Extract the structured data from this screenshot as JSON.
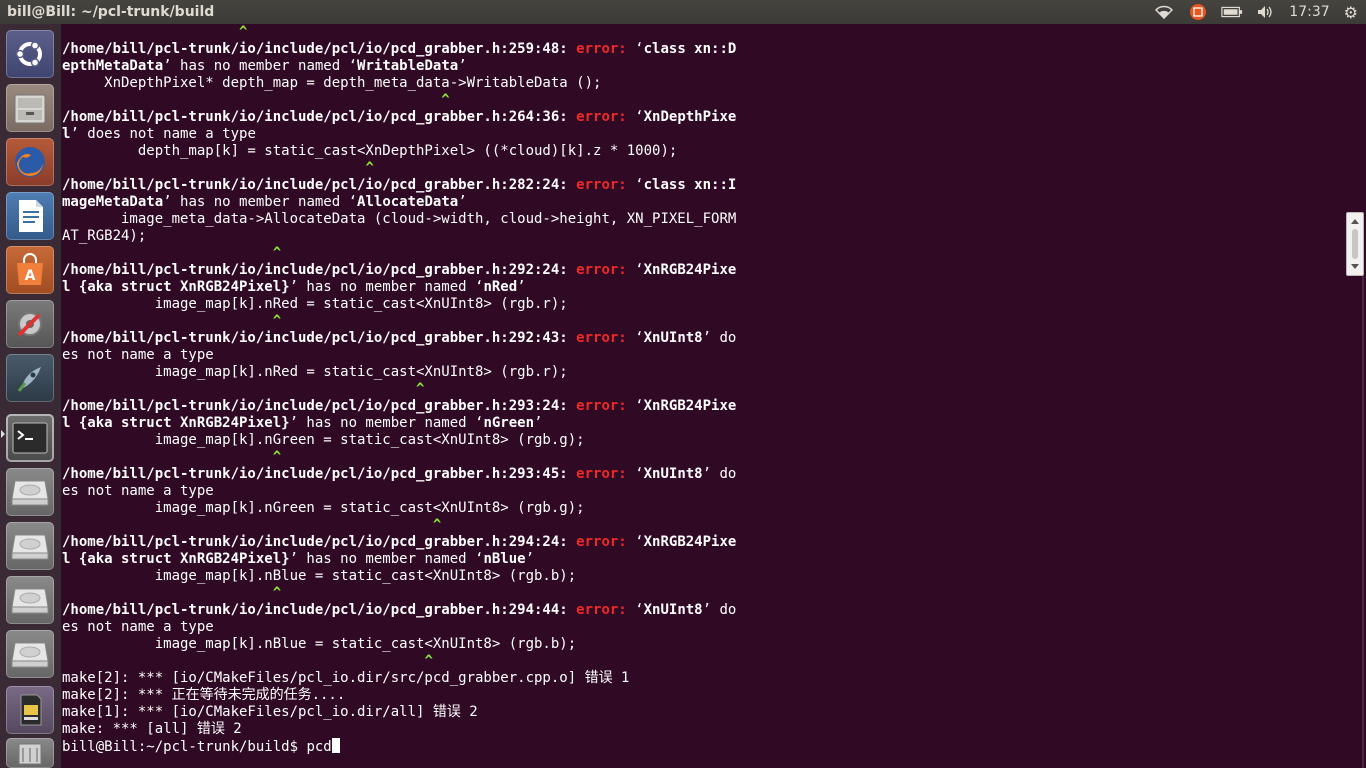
{
  "window": {
    "title": "bill@Bill: ~/pcl-trunk/build"
  },
  "topbar": {
    "clock": "17:37",
    "icons": [
      "wifi-icon",
      "input-method-icon",
      "battery-icon",
      "volume-icon",
      "gear-icon"
    ]
  },
  "launcher": {
    "items": [
      {
        "name": "ubuntu-dash",
        "icon": "ubuntu-logo-icon"
      },
      {
        "name": "files",
        "icon": "file-cabinet-icon"
      },
      {
        "name": "firefox",
        "icon": "firefox-icon"
      },
      {
        "name": "libreoffice-writer",
        "icon": "document-icon"
      },
      {
        "name": "software-center",
        "icon": "shopping-bag-icon"
      },
      {
        "name": "system-settings",
        "icon": "settings-icon"
      },
      {
        "name": "app-launcher",
        "icon": "rocket-icon"
      },
      {
        "name": "terminal",
        "icon": "terminal-icon",
        "active": true
      },
      {
        "name": "drive-1",
        "icon": "hard-drive-icon"
      },
      {
        "name": "drive-2",
        "icon": "hard-drive-icon"
      },
      {
        "name": "drive-3",
        "icon": "hard-drive-icon"
      },
      {
        "name": "drive-4",
        "icon": "hard-drive-icon"
      },
      {
        "name": "sd-card",
        "icon": "sd-card-icon"
      },
      {
        "name": "trash",
        "icon": "trash-icon"
      }
    ]
  },
  "terminal": {
    "prompt": "bill@Bill:~/pcl-trunk/build$ ",
    "input": "pcd",
    "lines": [
      [
        {
          "t": "                     "
        },
        {
          "t": "^",
          "c": "caret"
        }
      ],
      [
        {
          "t": "/home/bill/pcl-trunk/io/include/pcl/io/pcd_grabber.h:259:48: ",
          "c": "b"
        },
        {
          "t": "error: ",
          "c": "err"
        },
        {
          "t": "‘"
        },
        {
          "t": "class xn::D",
          "c": "b"
        }
      ],
      [
        {
          "t": "epthMetaData",
          "c": "b"
        },
        {
          "t": "’ has no member named ‘"
        },
        {
          "t": "WritableData",
          "c": "b"
        },
        {
          "t": "’"
        }
      ],
      [
        {
          "t": "     XnDepthPixel* depth_map = depth_meta_data->WritableData ();"
        }
      ],
      [
        {
          "t": "                                             "
        },
        {
          "t": "^",
          "c": "caret"
        }
      ],
      [
        {
          "t": "/home/bill/pcl-trunk/io/include/pcl/io/pcd_grabber.h:264:36: ",
          "c": "b"
        },
        {
          "t": "error: ",
          "c": "err"
        },
        {
          "t": "‘"
        },
        {
          "t": "XnDepthPixe",
          "c": "b"
        }
      ],
      [
        {
          "t": "l",
          "c": "b"
        },
        {
          "t": "’ does not name a type"
        }
      ],
      [
        {
          "t": "         depth_map[k] = static_cast<XnDepthPixel> ((*cloud)[k].z * 1000);"
        }
      ],
      [
        {
          "t": "                                    "
        },
        {
          "t": "^",
          "c": "caret"
        }
      ],
      [
        {
          "t": "/home/bill/pcl-trunk/io/include/pcl/io/pcd_grabber.h:282:24: ",
          "c": "b"
        },
        {
          "t": "error: ",
          "c": "err"
        },
        {
          "t": "‘"
        },
        {
          "t": "class xn::I",
          "c": "b"
        }
      ],
      [
        {
          "t": "mageMetaData",
          "c": "b"
        },
        {
          "t": "’ has no member named ‘"
        },
        {
          "t": "AllocateData",
          "c": "b"
        },
        {
          "t": "’"
        }
      ],
      [
        {
          "t": "       image_meta_data->AllocateData (cloud->width, cloud->height, XN_PIXEL_FORM"
        }
      ],
      [
        {
          "t": "AT_RGB24);"
        }
      ],
      [
        {
          "t": "                         "
        },
        {
          "t": "^",
          "c": "caret"
        }
      ],
      [
        {
          "t": "/home/bill/pcl-trunk/io/include/pcl/io/pcd_grabber.h:292:24: ",
          "c": "b"
        },
        {
          "t": "error: ",
          "c": "err"
        },
        {
          "t": "‘"
        },
        {
          "t": "XnRGB24Pixe",
          "c": "b"
        }
      ],
      [
        {
          "t": "l {aka struct XnRGB24Pixel}",
          "c": "b"
        },
        {
          "t": "’ has no member named ‘"
        },
        {
          "t": "nRed",
          "c": "b"
        },
        {
          "t": "’"
        }
      ],
      [
        {
          "t": "           image_map[k].nRed = static_cast<XnUInt8> (rgb.r);"
        }
      ],
      [
        {
          "t": "                         "
        },
        {
          "t": "^",
          "c": "caret"
        }
      ],
      [
        {
          "t": "/home/bill/pcl-trunk/io/include/pcl/io/pcd_grabber.h:292:43: ",
          "c": "b"
        },
        {
          "t": "error: ",
          "c": "err"
        },
        {
          "t": "‘"
        },
        {
          "t": "XnUInt8",
          "c": "b"
        },
        {
          "t": "’ do"
        }
      ],
      [
        {
          "t": "es not name a type"
        }
      ],
      [
        {
          "t": "           image_map[k].nRed = static_cast<XnUInt8> (rgb.r);"
        }
      ],
      [
        {
          "t": "                                          "
        },
        {
          "t": "^",
          "c": "caret"
        }
      ],
      [
        {
          "t": "/home/bill/pcl-trunk/io/include/pcl/io/pcd_grabber.h:293:24: ",
          "c": "b"
        },
        {
          "t": "error: ",
          "c": "err"
        },
        {
          "t": "‘"
        },
        {
          "t": "XnRGB24Pixe",
          "c": "b"
        }
      ],
      [
        {
          "t": "l {aka struct XnRGB24Pixel}",
          "c": "b"
        },
        {
          "t": "’ has no member named ‘"
        },
        {
          "t": "nGreen",
          "c": "b"
        },
        {
          "t": "’"
        }
      ],
      [
        {
          "t": "           image_map[k].nGreen = static_cast<XnUInt8> (rgb.g);"
        }
      ],
      [
        {
          "t": "                         "
        },
        {
          "t": "^",
          "c": "caret"
        }
      ],
      [
        {
          "t": "/home/bill/pcl-trunk/io/include/pcl/io/pcd_grabber.h:293:45: ",
          "c": "b"
        },
        {
          "t": "error: ",
          "c": "err"
        },
        {
          "t": "‘"
        },
        {
          "t": "XnUInt8",
          "c": "b"
        },
        {
          "t": "’ do"
        }
      ],
      [
        {
          "t": "es not name a type"
        }
      ],
      [
        {
          "t": "           image_map[k].nGreen = static_cast<XnUInt8> (rgb.g);"
        }
      ],
      [
        {
          "t": "                                            "
        },
        {
          "t": "^",
          "c": "caret"
        }
      ],
      [
        {
          "t": "/home/bill/pcl-trunk/io/include/pcl/io/pcd_grabber.h:294:24: ",
          "c": "b"
        },
        {
          "t": "error: ",
          "c": "err"
        },
        {
          "t": "‘"
        },
        {
          "t": "XnRGB24Pixe",
          "c": "b"
        }
      ],
      [
        {
          "t": "l {aka struct XnRGB24Pixel}",
          "c": "b"
        },
        {
          "t": "’ has no member named ‘"
        },
        {
          "t": "nBlue",
          "c": "b"
        },
        {
          "t": "’"
        }
      ],
      [
        {
          "t": "           image_map[k].nBlue = static_cast<XnUInt8> (rgb.b);"
        }
      ],
      [
        {
          "t": "                         "
        },
        {
          "t": "^",
          "c": "caret"
        }
      ],
      [
        {
          "t": "/home/bill/pcl-trunk/io/include/pcl/io/pcd_grabber.h:294:44: ",
          "c": "b"
        },
        {
          "t": "error: ",
          "c": "err"
        },
        {
          "t": "‘"
        },
        {
          "t": "XnUInt8",
          "c": "b"
        },
        {
          "t": "’ do"
        }
      ],
      [
        {
          "t": "es not name a type"
        }
      ],
      [
        {
          "t": "           image_map[k].nBlue = static_cast<XnUInt8> (rgb.b);"
        }
      ],
      [
        {
          "t": "                                           "
        },
        {
          "t": "^",
          "c": "caret"
        }
      ],
      [
        {
          "t": "make[2]: *** [io/CMakeFiles/pcl_io.dir/src/pcd_grabber.cpp.o] 错误 1"
        }
      ],
      [
        {
          "t": "make[2]: *** 正在等待未完成的任务...."
        }
      ],
      [
        {
          "t": "make[1]: *** [io/CMakeFiles/pcl_io.dir/all] 错误 2"
        }
      ],
      [
        {
          "t": "make: *** [all] 错误 2"
        }
      ]
    ]
  },
  "colors": {
    "terminal_bg": "#300a24",
    "error_red": "#ef2929",
    "caret_green": "#8ae234",
    "panel_bg": "#3c3b37",
    "launcher_bg": "#3a2a35"
  }
}
